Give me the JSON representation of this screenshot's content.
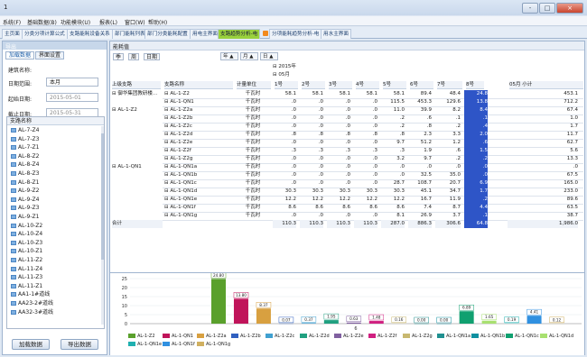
{
  "window": {
    "title": "1",
    "controls": [
      "-",
      "□",
      "×"
    ]
  },
  "menu": [
    "系统(F)",
    "基础数据(B)",
    "功能模块(U)",
    "报表(L)",
    "窗口(W)",
    "帮助(H)"
  ],
  "tabs": [
    "主页面",
    "分类分项计算公式",
    "支路能耗设备关系",
    "部门能耗列表",
    "部门分类能耗配置",
    "用电主界面",
    "支路趋势分析-电",
    "分项能耗趋势分析-电",
    "用水主界面"
  ],
  "active_tab": "支路趋势分析-电",
  "left": {
    "header": "导出",
    "subtabs": [
      "加载数据",
      "界面设置"
    ],
    "building_label": "建筑名称:",
    "date_type_label": "日期范围:",
    "date_type_value": "本月",
    "start_label": "起始日期:",
    "start_value": "2015-05-01",
    "end_label": "截止日期:",
    "end_value": "2015-05-31",
    "tree_header": "支路名称",
    "tree": [
      "AL-7-Z4",
      "AL-7-Z3",
      "AL-7-Z1",
      "AL-8-Z2",
      "AL-8-Z4",
      "AL-8-Z3",
      "AL-8-Z1",
      "AL-9-Z2",
      "AL-9-Z4",
      "AL-9-Z3",
      "AL-9-Z1",
      "AL-10-Z2",
      "AL-10-Z4",
      "AL-10-Z3",
      "AL-10-Z1",
      "AL-11-Z2",
      "AL-11-Z4",
      "AL-11-Z3",
      "AL-11-Z1",
      "AA1-1#道线",
      "AA23-2#道线",
      "AA32-3#道线"
    ],
    "load_button": "加载数据",
    "export_button": "导出数据"
  },
  "toolbar": {
    "label": "能耗值",
    "buttons": [
      "季",
      "周",
      "日期"
    ]
  },
  "pivot": {
    "top_fields": [
      "年",
      "月",
      "日"
    ],
    "year": "2015年",
    "month": "05月",
    "col_headers": [
      "上级支路",
      "支路名称",
      "计量单位",
      "1号",
      "2号",
      "3号",
      "4号",
      "5号",
      "6号",
      "7号",
      "8号",
      "05月 小计"
    ],
    "groups": [
      {
        "parent": "⊟ 御华集团教研楼...",
        "rows": [
          {
            "name": "⊟ AL-1-Z2",
            "unit": "千瓦时",
            "v": [
              "58.1",
              "58.1",
              "58.1",
              "58.1",
              "58.1",
              "89.4",
              "48.4",
              "24.8",
              "453.1"
            ]
          },
          {
            "name": "⊟ AL-1-QN1",
            "unit": "千瓦时",
            "v": [
              ".0",
              ".0",
              ".0",
              ".0",
              "115.5",
              "453.3",
              "129.6",
              "13.8",
              "712.2"
            ]
          }
        ]
      },
      {
        "parent": "⊟ AL-1-Z2",
        "rows": [
          {
            "name": "⊟ AL-1-Z2a",
            "unit": "千瓦时",
            "v": [
              ".0",
              ".0",
              ".0",
              ".0",
              "11.0",
              "39.9",
              "8.2",
              "8.4",
              "67.4"
            ]
          },
          {
            "name": "⊟ AL-1-Z2b",
            "unit": "千瓦时",
            "v": [
              ".0",
              ".0",
              ".0",
              ".0",
              ".2",
              ".6",
              ".1",
              ".1",
              "1.0"
            ]
          },
          {
            "name": "⊟ AL-1-Z2c",
            "unit": "千瓦时",
            "v": [
              ".0",
              ".0",
              ".0",
              ".0",
              ".2",
              ".8",
              ".2",
              ".4",
              "1.7"
            ]
          },
          {
            "name": "⊟ AL-1-Z2d",
            "unit": "千瓦时",
            "v": [
              ".8",
              ".8",
              ".8",
              ".8",
              ".8",
              "2.3",
              "3.3",
              "2.0",
              "11.7"
            ]
          },
          {
            "name": "⊟ AL-1-Z2e",
            "unit": "千瓦时",
            "v": [
              ".0",
              ".0",
              ".0",
              ".0",
              "9.7",
              "51.2",
              "1.2",
              ".6",
              "62.7"
            ]
          },
          {
            "name": "⊟ AL-1-Z2f",
            "unit": "千瓦时",
            "v": [
              ".3",
              ".3",
              ".3",
              ".3",
              ".3",
              "1.9",
              ".6",
              "1.5",
              "5.6"
            ]
          },
          {
            "name": "⊟ AL-1-Z2g",
            "unit": "千瓦时",
            "v": [
              ".0",
              ".0",
              ".0",
              ".0",
              "3.2",
              "9.7",
              ".2",
              ".2",
              "13.3"
            ]
          }
        ]
      },
      {
        "parent": "⊟ AL-1-QN1",
        "rows": [
          {
            "name": "⊟ AL-1-QN1a",
            "unit": "千瓦时",
            "v": [
              ".0",
              ".0",
              ".0",
              ".0",
              ".0",
              ".0",
              ".0",
              ".0",
              ".0"
            ]
          },
          {
            "name": "⊟ AL-1-QN1b",
            "unit": "千瓦时",
            "v": [
              ".0",
              ".0",
              ".0",
              ".0",
              ".0",
              "32.5",
              "35.0",
              ".0",
              "67.5"
            ]
          },
          {
            "name": "⊟ AL-1-QN1c",
            "unit": "千瓦时",
            "v": [
              ".0",
              ".0",
              ".0",
              ".0",
              "28.7",
              "108.7",
              "20.7",
              "6.9",
              "165.0"
            ]
          },
          {
            "name": "⊟ AL-1-QN1d",
            "unit": "千瓦时",
            "v": [
              "30.3",
              "30.3",
              "30.3",
              "30.3",
              "30.3",
              "45.1",
              "34.7",
              "1.7",
              "233.0"
            ]
          },
          {
            "name": "⊟ AL-1-QN1e",
            "unit": "千瓦时",
            "v": [
              "12.2",
              "12.2",
              "12.2",
              "12.2",
              "12.2",
              "16.7",
              "11.9",
              ".2",
              "89.6"
            ]
          },
          {
            "name": "⊟ AL-1-QN1f",
            "unit": "千瓦时",
            "v": [
              "8.6",
              "8.6",
              "8.6",
              "8.6",
              "8.6",
              "7.4",
              "8.7",
              "4.4",
              "63.5"
            ]
          },
          {
            "name": "⊟ AL-1-QN1g",
            "unit": "千瓦时",
            "v": [
              ".0",
              ".0",
              ".0",
              ".0",
              "8.1",
              "26.9",
              "3.7",
              ".1",
              "38.7"
            ]
          }
        ]
      }
    ],
    "total_label": "合计",
    "total": [
      "110.3",
      "110.3",
      "110.3",
      "110.3",
      "287.0",
      "886.3",
      "306.6",
      "64.8",
      "1,986.0"
    ]
  },
  "chart_data": {
    "type": "bar",
    "xlabel": "6",
    "ylim": [
      0,
      25
    ],
    "yticks": [
      0,
      5,
      10,
      15,
      20,
      25
    ],
    "series": [
      {
        "name": "AL-1-Z2",
        "value": 24.8,
        "color": "#5aa02c"
      },
      {
        "name": "AL-1-QN1",
        "value": 13.8,
        "color": "#c0145a"
      },
      {
        "name": "AL-1-Z2a",
        "value": 8.37,
        "color": "#d8a040"
      },
      {
        "name": "AL-1-Z2b",
        "value": 0.07,
        "color": "#3060c0"
      },
      {
        "name": "AL-1-Z2c",
        "value": 0.37,
        "color": "#40a0d0"
      },
      {
        "name": "AL-1-Z2d",
        "value": 1.95,
        "color": "#20a080"
      },
      {
        "name": "AL-1-Z2e",
        "value": 0.63,
        "color": "#8060a0"
      },
      {
        "name": "AL-1-Z2f",
        "value": 1.48,
        "color": "#d02080"
      },
      {
        "name": "AL-1-Z2g",
        "value": 0.16,
        "color": "#c8b870"
      },
      {
        "name": "AL-1-QN1a",
        "value": 0.0,
        "color": "#209090"
      },
      {
        "name": "AL-1-QN1b",
        "value": 0.0,
        "color": "#1090a0"
      },
      {
        "name": "AL-1-QN1c",
        "value": 6.89,
        "color": "#10a070"
      },
      {
        "name": "AL-1-QN1d",
        "value": 1.65,
        "color": "#a8e070"
      },
      {
        "name": "AL-1-QN1e",
        "value": 0.19,
        "color": "#20b0b0"
      },
      {
        "name": "AL-1-QN1f",
        "value": 4.41,
        "color": "#3090e0"
      },
      {
        "name": "AL-1-QN1g",
        "value": 0.12,
        "color": "#d0b060"
      }
    ]
  }
}
